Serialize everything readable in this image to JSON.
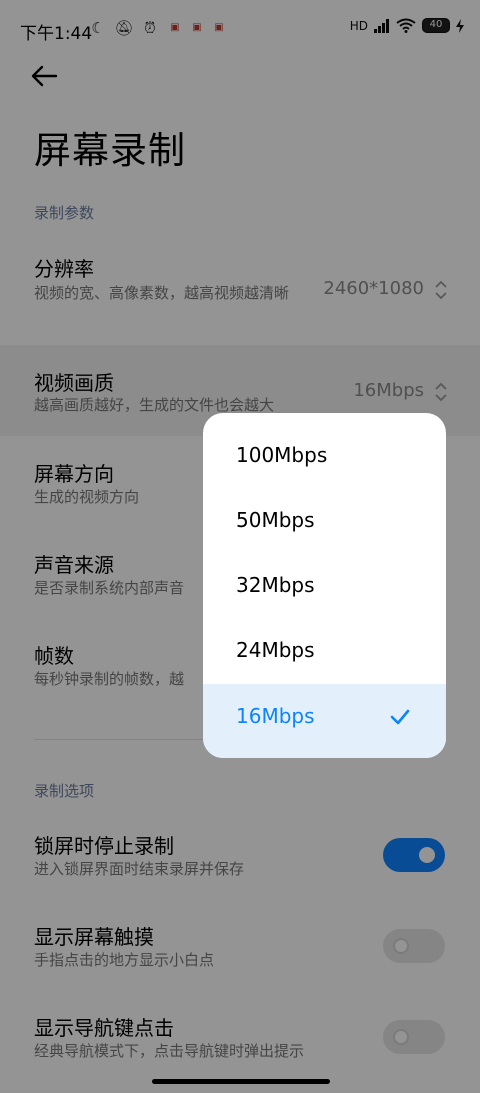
{
  "status_bar": {
    "time": "下午1:44",
    "left_icons": [
      "moon-icon",
      "bell-off-icon",
      "alarm-icon",
      "app-notification-icon",
      "app-notification-icon",
      "app-notification-icon"
    ],
    "network": "HD",
    "battery": "40",
    "charging": true
  },
  "header": {
    "back_icon": "arrow-left-icon",
    "title": "屏幕录制"
  },
  "sections": [
    {
      "label": "录制参数",
      "items": [
        {
          "title": "分辨率",
          "subtitle": "视频的宽、高像素数，越高视频越清晰",
          "value": "2460*1080"
        },
        {
          "title": "视频画质",
          "subtitle": "越高画质越好，生成的文件也会越大",
          "value": "16Mbps"
        },
        {
          "title": "屏幕方向",
          "subtitle": "生成的视频方向"
        },
        {
          "title": "声音来源",
          "subtitle": "是否录制系统内部声音"
        },
        {
          "title": "帧数",
          "subtitle": "每秒钟录制的帧数，越"
        }
      ]
    },
    {
      "label": "录制选项",
      "items": [
        {
          "title": "锁屏时停止录制",
          "subtitle": "进入锁屏界面时结束录屏并保存",
          "toggle": true
        },
        {
          "title": "显示屏幕触摸",
          "subtitle": "手指点击的地方显示小白点",
          "toggle": false
        },
        {
          "title": "显示导航键点击",
          "subtitle": "经典导航模式下，点击导航键时弹出提示",
          "toggle": false
        }
      ]
    }
  ],
  "dropdown": {
    "options": [
      "100Mbps",
      "50Mbps",
      "32Mbps",
      "24Mbps",
      "16Mbps"
    ],
    "selected": "16Mbps"
  },
  "colors": {
    "accent": "#0d84ff",
    "selected_bg": "#e3f0fc",
    "section_label": "#6b7aa0"
  }
}
